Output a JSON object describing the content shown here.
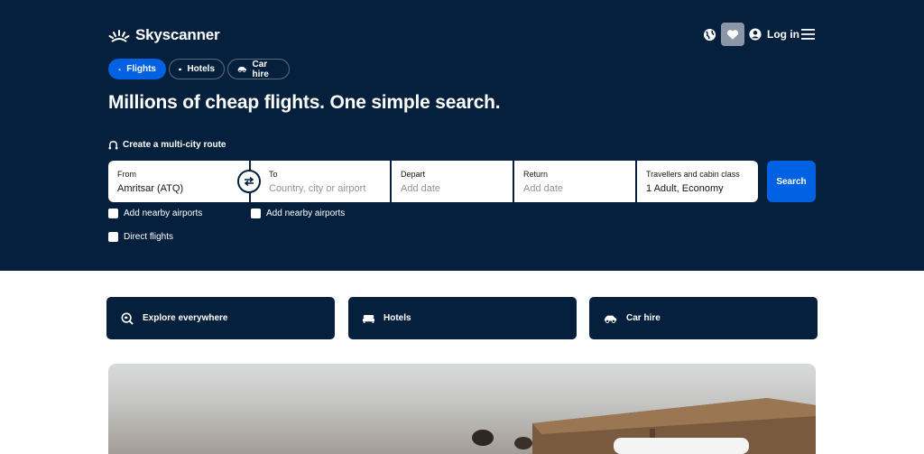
{
  "brand": {
    "name": "Skyscanner"
  },
  "header": {
    "login_label": "Log in"
  },
  "tabs": [
    {
      "label": "Flights",
      "active": true
    },
    {
      "label": "Hotels",
      "active": false
    },
    {
      "label": "Car hire",
      "active": false
    }
  ],
  "hero": {
    "headline": "Millions of cheap flights. One simple search.",
    "multicity_label": "Create a multi-city route"
  },
  "search": {
    "from": {
      "label": "From",
      "value": "Amritsar (ATQ)"
    },
    "to": {
      "label": "To",
      "placeholder": "Country, city or airport"
    },
    "depart": {
      "label": "Depart",
      "placeholder": "Add date"
    },
    "return": {
      "label": "Return",
      "placeholder": "Add date"
    },
    "travellers": {
      "label": "Travellers and cabin class",
      "value": "1 Adult, Economy"
    },
    "button_label": "Search"
  },
  "options": {
    "nearby_from": "Add nearby airports",
    "nearby_to": "Add nearby airports",
    "direct": "Direct flights"
  },
  "quick_links": [
    {
      "label": "Explore everywhere",
      "icon": "explore-icon"
    },
    {
      "label": "Hotels",
      "icon": "bed-icon"
    },
    {
      "label": "Car hire",
      "icon": "car-icon"
    }
  ],
  "colors": {
    "navy": "#05203c",
    "accent": "#0062e3"
  }
}
